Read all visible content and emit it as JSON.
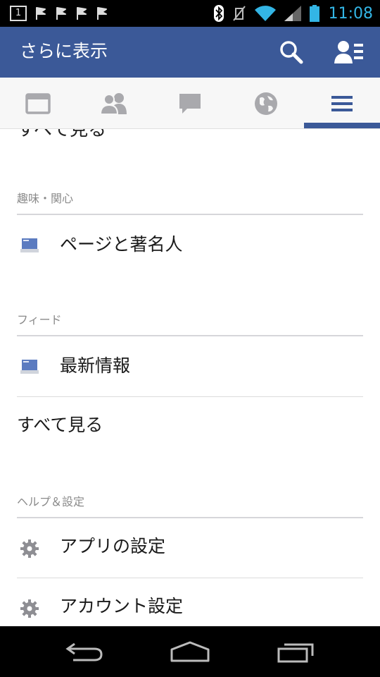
{
  "status_bar": {
    "notification_badge": "1",
    "time": "11:08",
    "colors": {
      "time": "#33b5e5",
      "wifi": "#33b5e5",
      "battery": "#33b5e5"
    }
  },
  "header": {
    "title": "さらに表示",
    "background": "#3b5998",
    "icons": [
      "search-icon",
      "friend-requests-icon"
    ]
  },
  "tabs": [
    {
      "name": "news-feed",
      "icon": "news-feed-icon",
      "active": false
    },
    {
      "name": "friends",
      "icon": "friends-icon",
      "active": false
    },
    {
      "name": "messages",
      "icon": "chat-bubble-icon",
      "active": false
    },
    {
      "name": "notifications",
      "icon": "globe-icon",
      "active": false
    },
    {
      "name": "more",
      "icon": "hamburger-menu-icon",
      "active": true
    }
  ],
  "content": {
    "cut_off_item": "すべて見る",
    "sections": [
      {
        "title": "趣味・関心",
        "items": [
          {
            "label": "ページと著名人",
            "icon": "page-icon"
          }
        ]
      },
      {
        "title": "フィード",
        "items": [
          {
            "label": "最新情報",
            "icon": "feed-icon"
          },
          {
            "label": "すべて見る",
            "icon": ""
          }
        ]
      },
      {
        "title": "ヘルプ＆設定",
        "items": [
          {
            "label": "アプリの設定",
            "icon": "gear-icon"
          },
          {
            "label": "アカウント設定",
            "icon": "gear-icon"
          }
        ]
      }
    ]
  },
  "nav_bar": {
    "buttons": [
      "back-icon",
      "home-icon",
      "recent-apps-icon"
    ]
  }
}
